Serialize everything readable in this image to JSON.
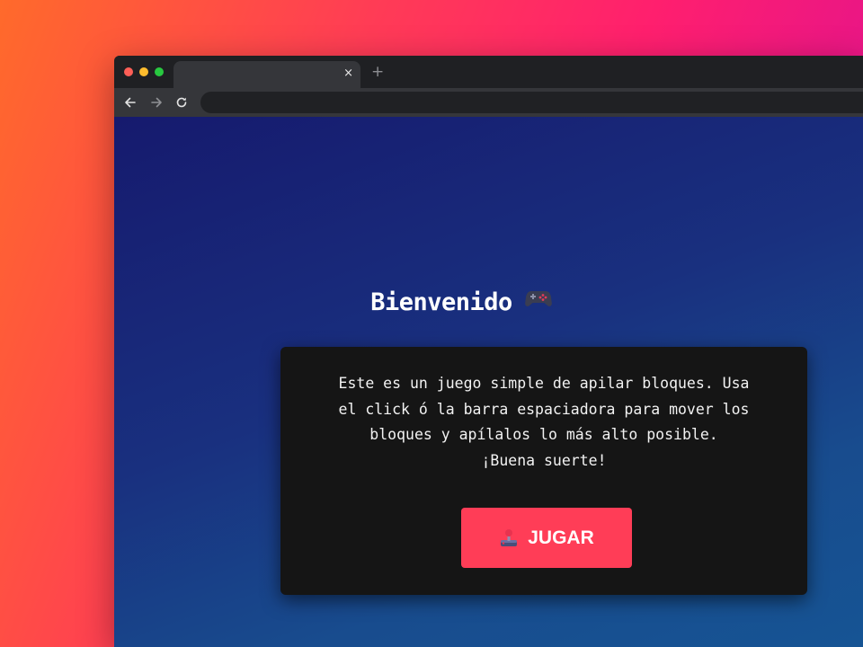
{
  "browser": {
    "tab": {
      "title": "",
      "close_glyph": "×"
    },
    "new_tab_glyph": "+",
    "address": {
      "url": ""
    },
    "icons": {
      "back": "arrow-left-icon",
      "forward": "arrow-right-icon",
      "reload": "reload-icon"
    }
  },
  "page": {
    "title": "Bienvenido",
    "title_icon": "gamepad-icon",
    "description": [
      "Este es un juego simple de apilar bloques. Usa",
      "el click ó la barra espaciadora para mover los",
      "bloques y apílalos lo más alto posible.",
      "¡Buena suerte!"
    ],
    "play_button": {
      "label": "JUGAR",
      "icon": "joystick-icon"
    }
  },
  "colors": {
    "accent": "#ff3d57",
    "card": "#151515",
    "page_bg_start": "#161a6e",
    "page_bg_end": "#165494"
  }
}
